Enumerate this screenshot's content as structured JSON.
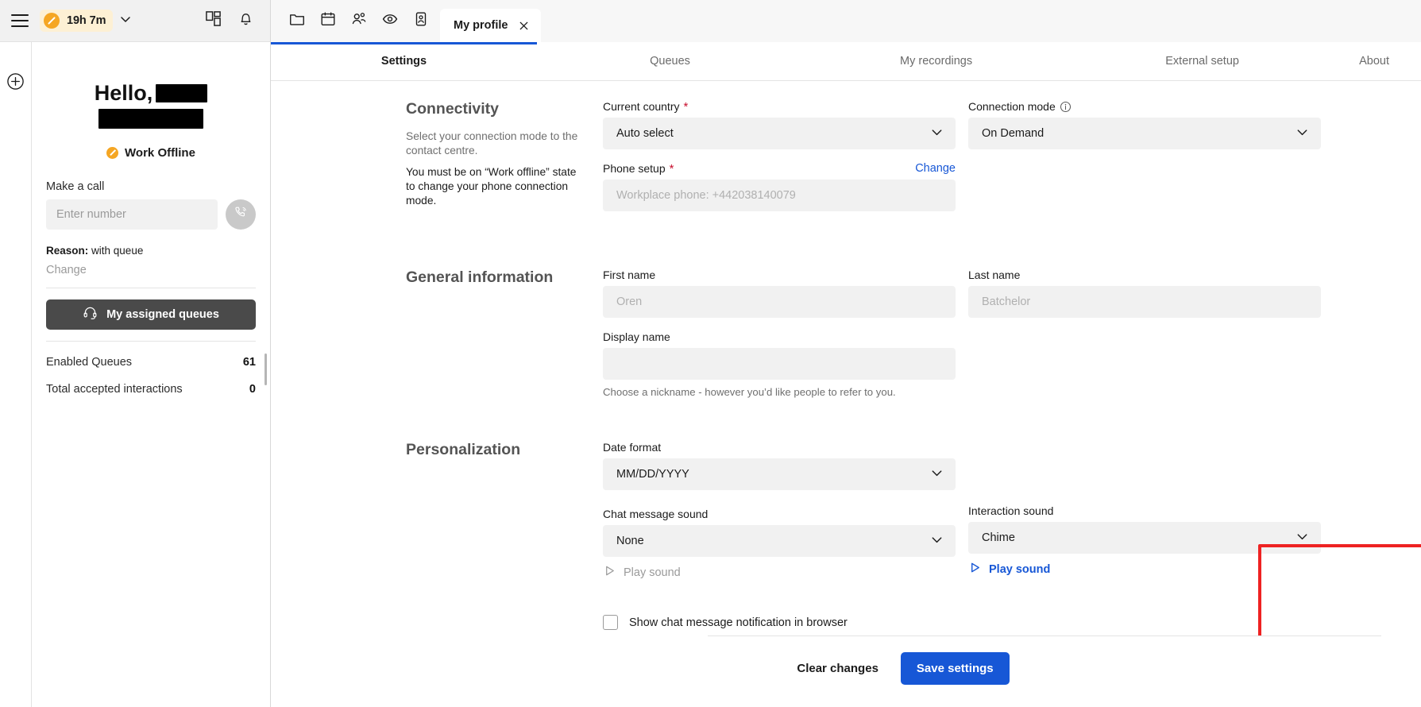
{
  "left_panel": {
    "status": {
      "time": "19h 7m",
      "icon": "offline-status-icon"
    },
    "greeting": "Hello,",
    "presence": "Work Offline",
    "make_a_call_label": "Make a call",
    "phone_placeholder": "Enter number",
    "reason_label": "Reason:",
    "reason_value": "with queue",
    "change_label": "Change",
    "queues_button": "My assigned queues",
    "stats": [
      {
        "label": "Enabled Queues",
        "value": "61"
      },
      {
        "label": "Total accepted interactions",
        "value": "0"
      }
    ]
  },
  "tabbar": {
    "icons": [
      "folder-icon",
      "calendar-icon",
      "people-icon",
      "eye-icon",
      "contact-card-icon"
    ],
    "active_tab": "My profile"
  },
  "navtabs": [
    {
      "label": "Settings",
      "active": true
    },
    {
      "label": "Queues",
      "active": false
    },
    {
      "label": "My recordings",
      "active": false
    },
    {
      "label": "External setup",
      "active": false
    },
    {
      "label": "About",
      "active": false
    }
  ],
  "connectivity": {
    "title": "Connectivity",
    "desc1": "Select your connection mode to the contact centre.",
    "desc2": "You must be on “Work offline” state to change your phone connection mode.",
    "current_country_label": "Current country",
    "current_country_value": "Auto select",
    "connection_mode_label": "Connection mode",
    "connection_mode_value": "On Demand",
    "phone_setup_label": "Phone setup",
    "phone_setup_value": "Workplace phone: +442038140079",
    "change_link": "Change"
  },
  "general_information": {
    "title": "General information",
    "first_name_label": "First name",
    "first_name_placeholder": "Oren",
    "last_name_label": "Last name",
    "last_name_placeholder": "Batchelor",
    "display_name_label": "Display name",
    "display_name_value": "",
    "display_name_hint": "Choose a nickname - however you’d like people to refer to you."
  },
  "personalization": {
    "title": "Personalization",
    "date_format_label": "Date format",
    "date_format_value": "MM/DD/YYYY",
    "chat_sound_label": "Chat message sound",
    "chat_sound_value": "None",
    "chat_play_label": "Play sound",
    "interaction_sound_label": "Interaction sound",
    "interaction_sound_value": "Chime",
    "interaction_play_label": "Play sound",
    "checkbox_label": "Show chat message notification in browser",
    "checkbox_checked": false
  },
  "footer": {
    "clear_label": "Clear changes",
    "save_label": "Save settings"
  },
  "colors": {
    "accent_blue": "#1757d6",
    "status_amber": "#f5a623",
    "required_red": "#c8102e",
    "highlight_red": "#ee2222",
    "dark_button": "#4a4a4a"
  }
}
